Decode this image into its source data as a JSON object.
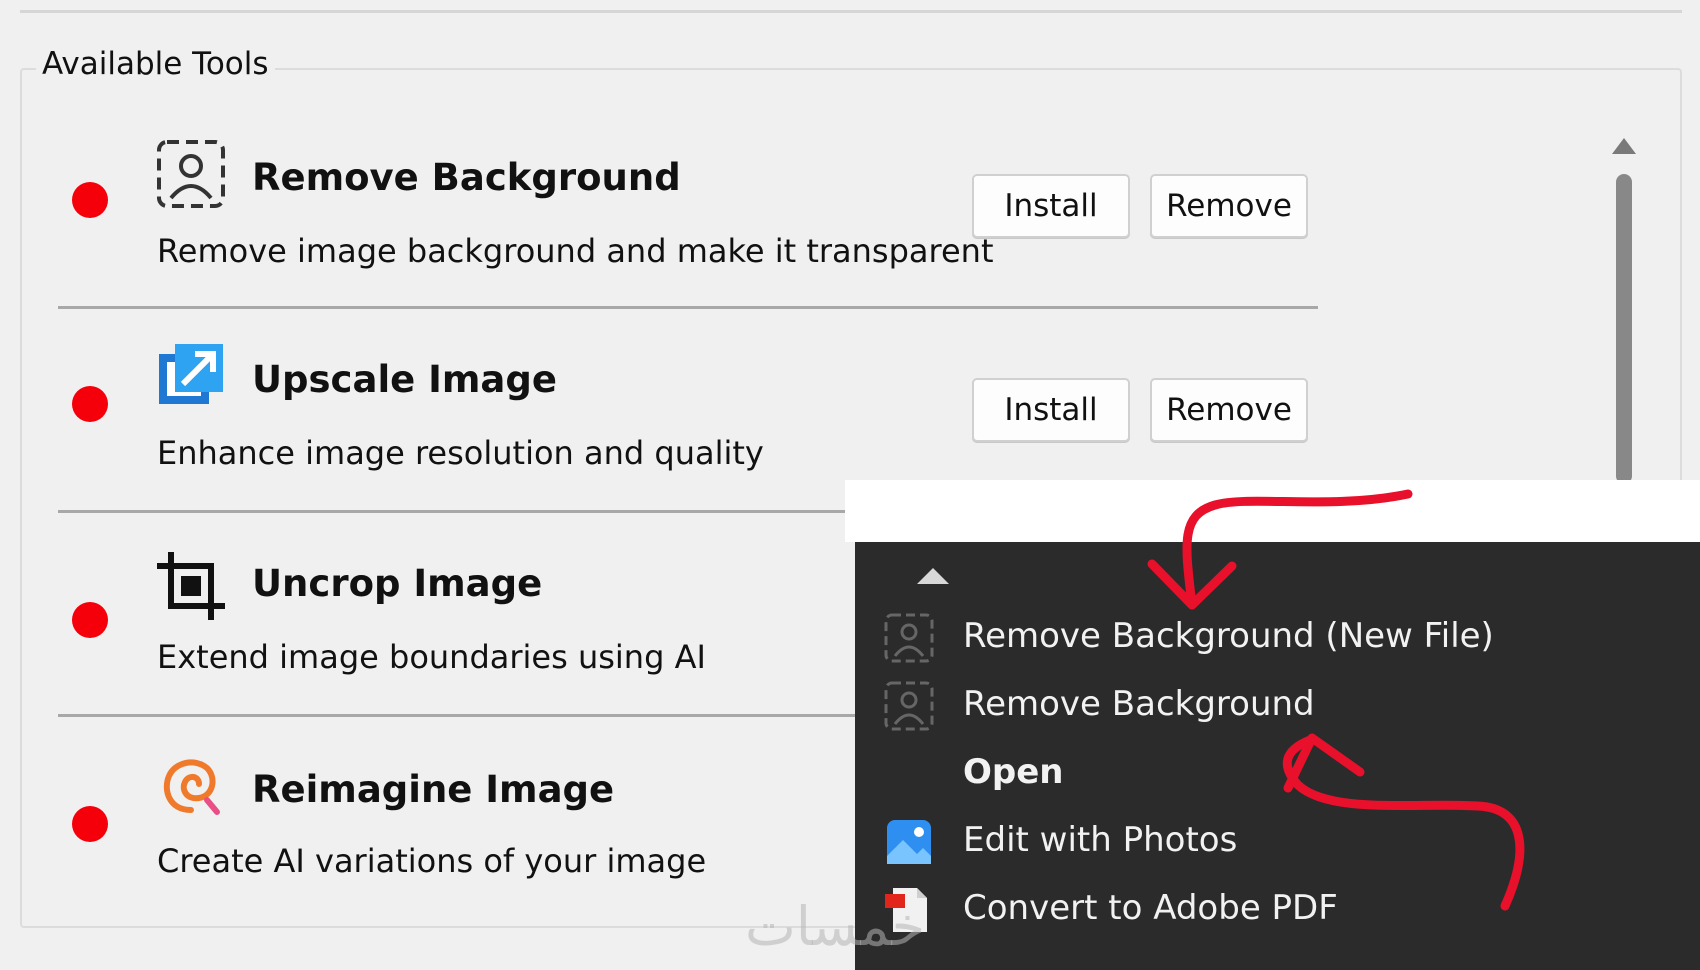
{
  "group": {
    "legend": "Available Tools"
  },
  "tools": [
    {
      "title": "Remove Background",
      "description": "Remove image background and make it transparent",
      "icon": "remove-background-icon",
      "install_label": "Install",
      "remove_label": "Remove",
      "status_color": "#f5000a"
    },
    {
      "title": "Upscale Image",
      "description": "Enhance image resolution and quality",
      "icon": "upscale-icon",
      "install_label": "Install",
      "remove_label": "Remove",
      "status_color": "#f5000a"
    },
    {
      "title": "Uncrop Image",
      "description": "Extend image boundaries using AI",
      "icon": "crop-icon",
      "status_color": "#f5000a"
    },
    {
      "title": "Reimagine Image",
      "description": "Create AI variations of your image",
      "icon": "reimagine-spiral-icon",
      "status_color": "#f5000a"
    }
  ],
  "context_menu": {
    "items": [
      {
        "label": "Remove Background (New File)",
        "icon": "remove-background-icon"
      },
      {
        "label": "Remove Background",
        "icon": "remove-background-icon"
      },
      {
        "label": "Open",
        "icon": ""
      },
      {
        "label": "Edit with Photos",
        "icon": "photos-icon"
      },
      {
        "label": "Convert to Adobe PDF",
        "icon": "adobe-pdf-icon"
      }
    ]
  },
  "watermark": "خمسات",
  "colors": {
    "accent_red": "#e8102a",
    "menu_bg": "#2b2b2b",
    "status": "#f5000a"
  }
}
